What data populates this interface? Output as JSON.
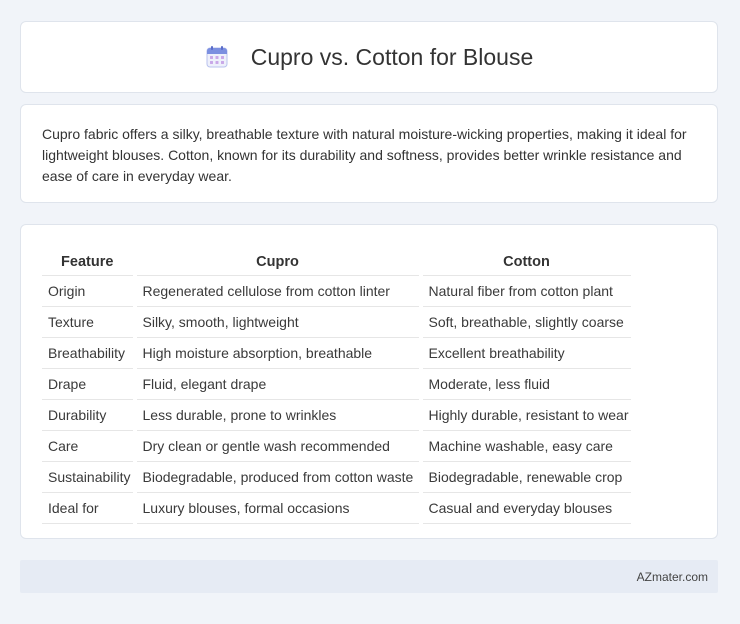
{
  "header": {
    "title": "Cupro vs. Cotton for Blouse",
    "icon": "calendar-icon"
  },
  "intro": {
    "text": "Cupro fabric offers a silky, breathable texture with natural moisture-wicking properties, making it ideal for lightweight blouses. Cotton, known for its durability and softness, provides better wrinkle resistance and ease of care in everyday wear."
  },
  "table": {
    "headers": [
      "Feature",
      "Cupro",
      "Cotton"
    ],
    "rows": [
      [
        "Origin",
        "Regenerated cellulose from cotton linter",
        "Natural fiber from cotton plant"
      ],
      [
        "Texture",
        "Silky, smooth, lightweight",
        "Soft, breathable, slightly coarse"
      ],
      [
        "Breathability",
        "High moisture absorption, breathable",
        "Excellent breathability"
      ],
      [
        "Drape",
        "Fluid, elegant drape",
        "Moderate, less fluid"
      ],
      [
        "Durability",
        "Less durable, prone to wrinkles",
        "Highly durable, resistant to wear"
      ],
      [
        "Care",
        "Dry clean or gentle wash recommended",
        "Machine washable, easy care"
      ],
      [
        "Sustainability",
        "Biodegradable, produced from cotton waste",
        "Biodegradable, renewable crop"
      ],
      [
        "Ideal for",
        "Luxury blouses, formal occasions",
        "Casual and everyday blouses"
      ]
    ]
  },
  "footer": {
    "text": "AZmater.com"
  },
  "colors": {
    "background": "#f1f4f9",
    "card": "#ffffff",
    "footer_bg": "#e6ebf4",
    "icon_accent": "#7b8fe0"
  }
}
